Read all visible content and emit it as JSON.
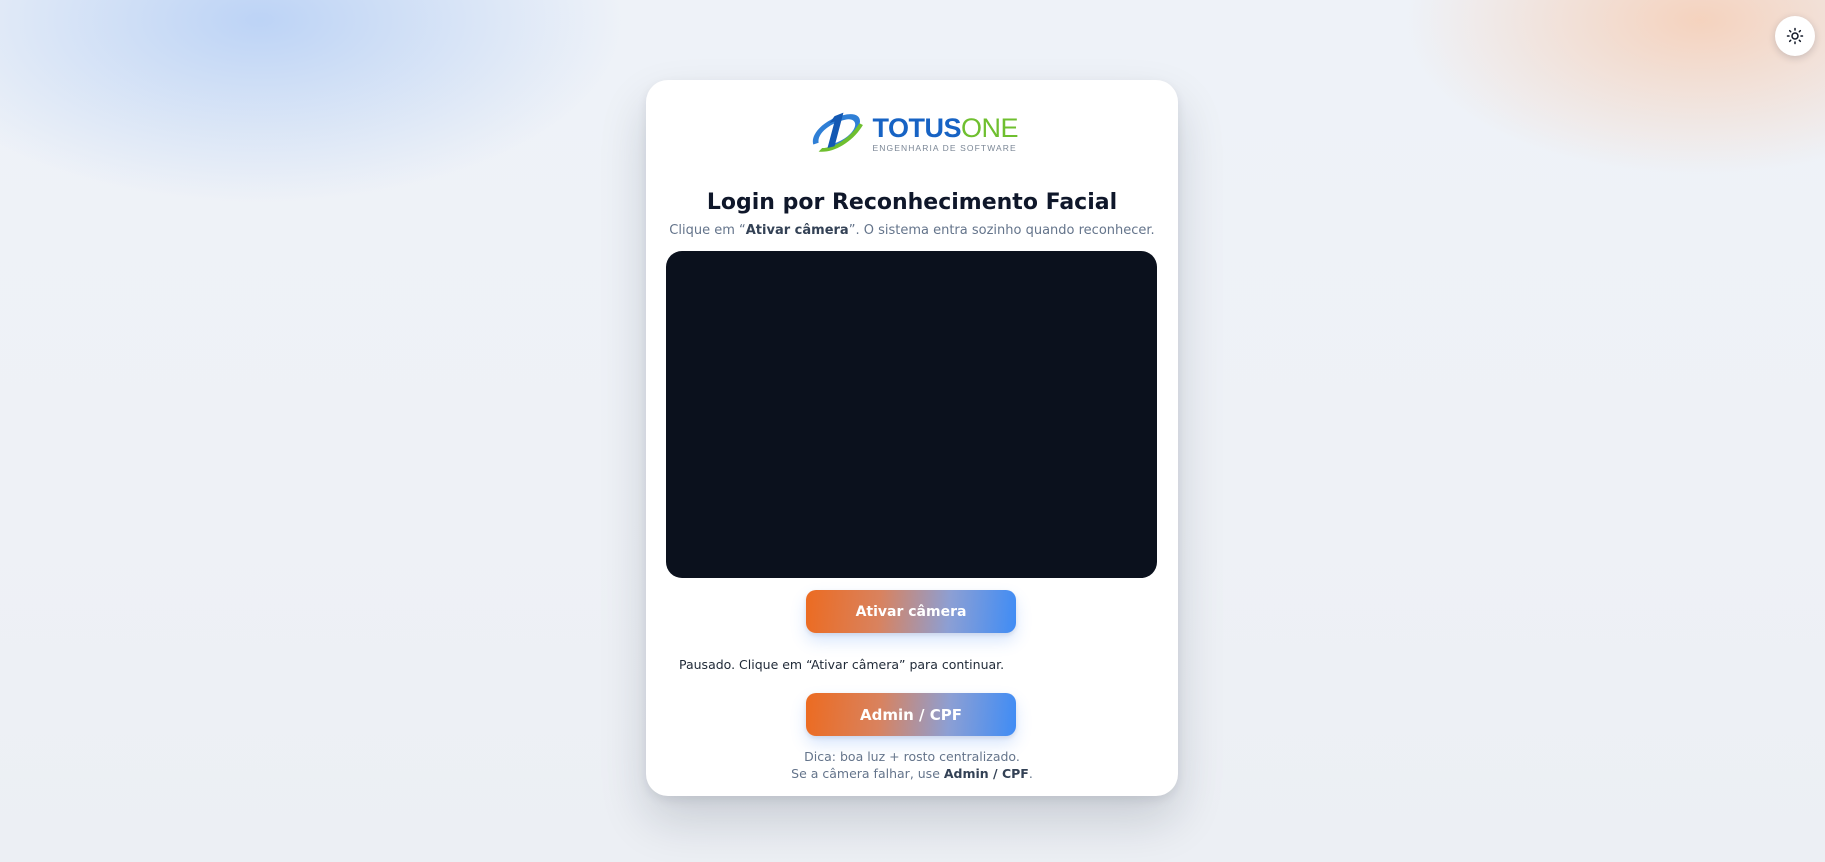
{
  "header": {
    "theme_toggle_icon": "sun-icon"
  },
  "brand": {
    "name_part1": "TOTUS",
    "name_part2": "ONE",
    "tagline": "ENGENHARIA DE SOFTWARE",
    "colors": {
      "blue": "#1763c4",
      "green": "#6fbf2f"
    }
  },
  "login": {
    "title": "Login por Reconhecimento Facial",
    "subtitle_prefix": "Clique em “",
    "subtitle_action": "Ativar câmera",
    "subtitle_suffix": "”. O sistema entra sozinho quando reconhecer.",
    "activate_camera_label": "Ativar câmera",
    "status_text": "Pausado. Clique em “Ativar câmera” para continuar.",
    "admin_button_label": "Admin / CPF",
    "tip_line1": "Dica: boa luz + rosto centralizado.",
    "tip_line2_prefix": "Se a câmera falhar, use ",
    "tip_line2_link": "Admin / CPF",
    "tip_line2_suffix": "."
  },
  "colors": {
    "accent_orange": "#ec6b21",
    "accent_blue": "#3f8cf5",
    "video_background": "#0b111d"
  }
}
